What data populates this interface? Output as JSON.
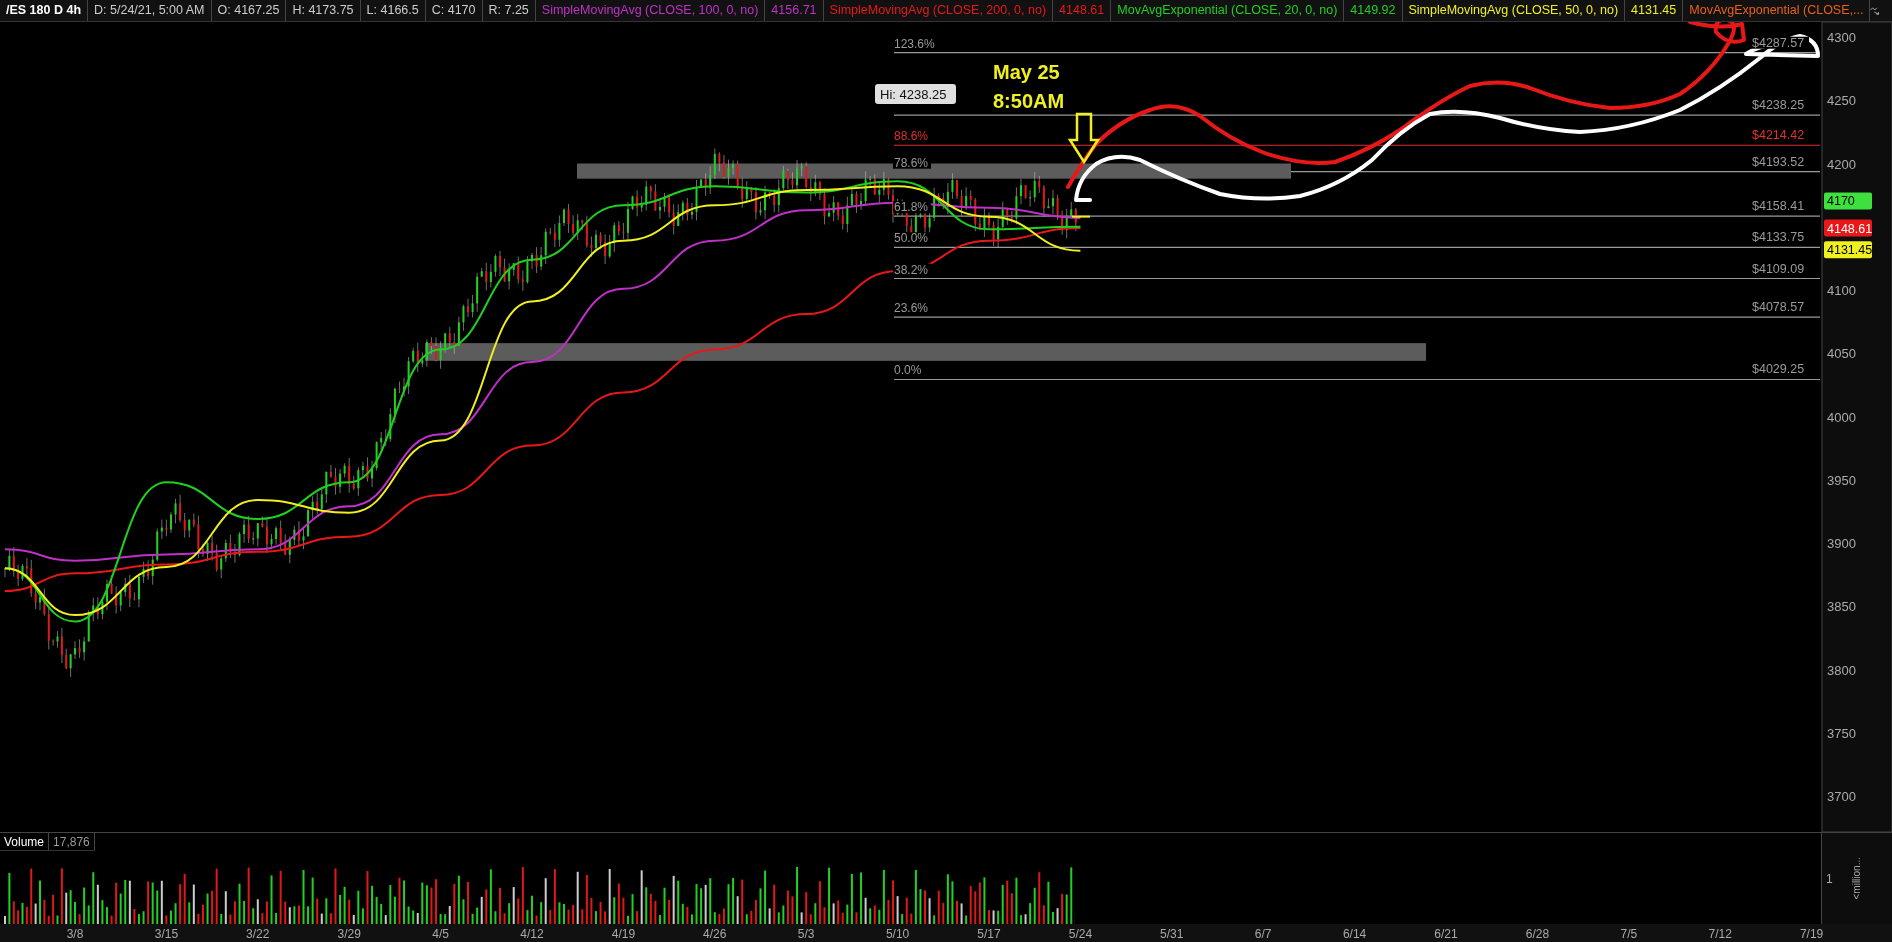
{
  "header": {
    "symbol": "/ES 180 D 4h",
    "fields": [
      "D: 5/24/21, 5:00 AM",
      "O: 4167.25",
      "H: 4173.75",
      "L: 4166.5",
      "C: 4170",
      "R: 7.25"
    ],
    "studies": [
      {
        "name": "SimpleMovingAvg (CLOSE, 100, 0, no)",
        "value": "4156.71",
        "color": "#c030c8"
      },
      {
        "name": "SimpleMovingAvg (CLOSE, 200, 0, no)",
        "value": "4148.61",
        "color": "#e81818"
      },
      {
        "name": "MovAvgExponential (CLOSE, 20, 0, no)",
        "value": "4149.92",
        "color": "#20d020"
      },
      {
        "name": "SimpleMovingAvg (CLOSE, 50, 0, no)",
        "value": "4131.45",
        "color": "#f0f020"
      },
      {
        "name": "MovAvgExponential (CLOSE,...",
        "color": "#e8601a"
      }
    ]
  },
  "price_chart": {
    "price_axis_labels": [
      "4300",
      "4250",
      "4200",
      "4100",
      "4050",
      "4000",
      "3950",
      "3900",
      "3850",
      "3800",
      "3750",
      "3700"
    ],
    "fib_levels": [
      {
        "label": "123.6%",
        "price": "$4287.57",
        "color": "#9a9a9a"
      },
      {
        "price": "$4238.25",
        "color": "#9a9a9a"
      },
      {
        "label": "88.6%",
        "price": "$4214.42",
        "color": "#e03030"
      },
      {
        "label": "78.6%",
        "price": "$4193.52",
        "color": "#9a9a9a"
      },
      {
        "label": "61.8%",
        "price": "$4158.41",
        "color": "#9a9a9a"
      },
      {
        "label": "50.0%",
        "price": "$4133.75",
        "color": "#9a9a9a"
      },
      {
        "label": "38.2%",
        "price": "$4109.09",
        "color": "#9a9a9a"
      },
      {
        "label": "23.6%",
        "price": "$4078.57",
        "color": "#9a9a9a"
      },
      {
        "label": "0.0%",
        "price": "$4029.25",
        "color": "#9a9a9a"
      }
    ],
    "high_label": "Hi: 4238.25",
    "notes": [
      "May 25",
      "8:50AM"
    ],
    "badges": [
      {
        "text": "4170",
        "color": "#3ee03e"
      },
      {
        "text": "4148.61",
        "color": "#e81818"
      },
      {
        "text": "4131.45",
        "color": "#f0f020"
      }
    ]
  },
  "volume": {
    "title": "Volume",
    "value": "17,876",
    "axis_label": "1",
    "unit_label": "<million..."
  },
  "date_axis_labels": [
    "3/8",
    "3/15",
    "3/22",
    "3/29",
    "4/5",
    "4/12",
    "4/19",
    "4/26",
    "5/3",
    "5/10",
    "5/17",
    "5/24",
    "5/31",
    "6/7",
    "6/14",
    "6/21",
    "6/28",
    "7/5",
    "7/12",
    "7/19"
  ]
}
